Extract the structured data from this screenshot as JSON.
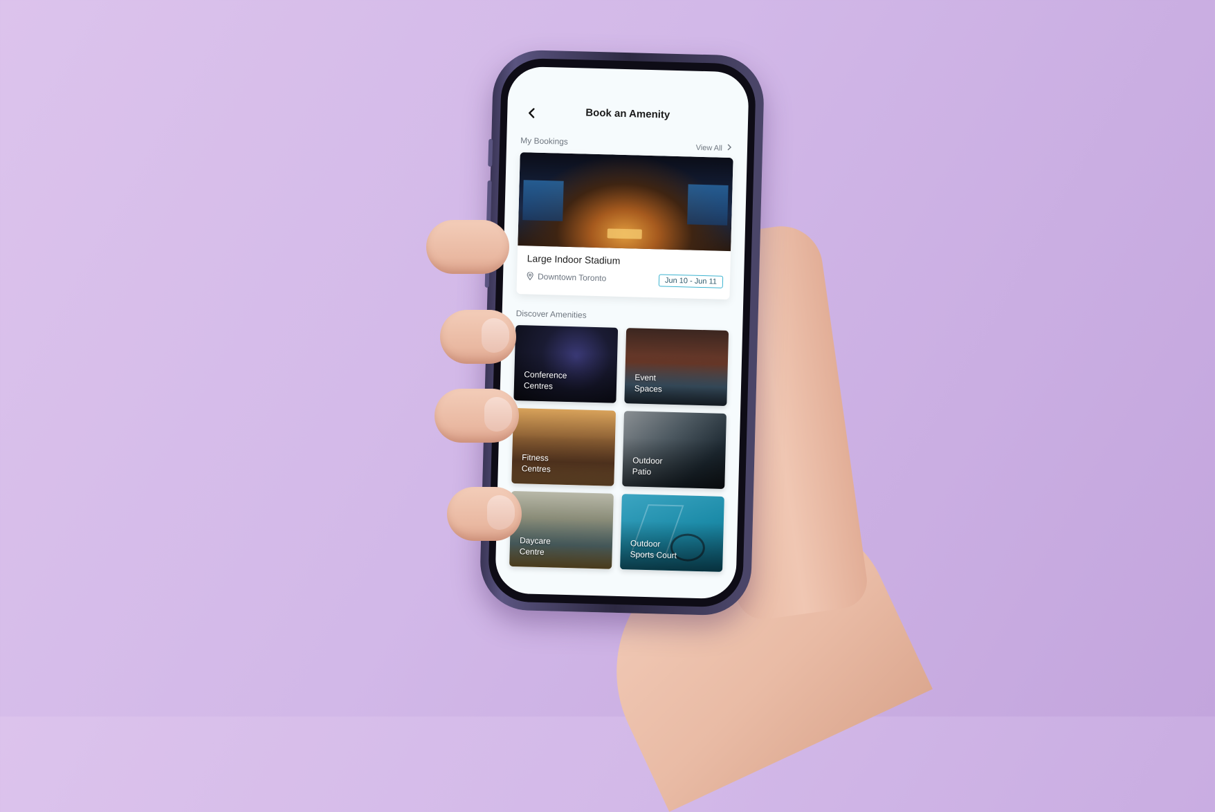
{
  "header": {
    "back_label": "‹",
    "title": "Book an Amenity"
  },
  "my_bookings": {
    "label": "My Bookings",
    "view_all": "View All",
    "card": {
      "title": "Large Indoor Stadium",
      "location": "Downtown Toronto",
      "dates": "Jun 10 - Jun 11"
    }
  },
  "discover": {
    "label": "Discover Amenities",
    "tiles": [
      {
        "label": "Conference\nCentres"
      },
      {
        "label": "Event\nSpaces"
      },
      {
        "label": "Fitness\nCentres"
      },
      {
        "label": "Outdoor\nPatio"
      },
      {
        "label": "Daycare\nCentre"
      },
      {
        "label": "Outdoor\nSports Court"
      }
    ]
  },
  "colors": {
    "background": "#d4b9e8",
    "accent": "#3bb3d0",
    "screen": "#f6fbfd"
  }
}
